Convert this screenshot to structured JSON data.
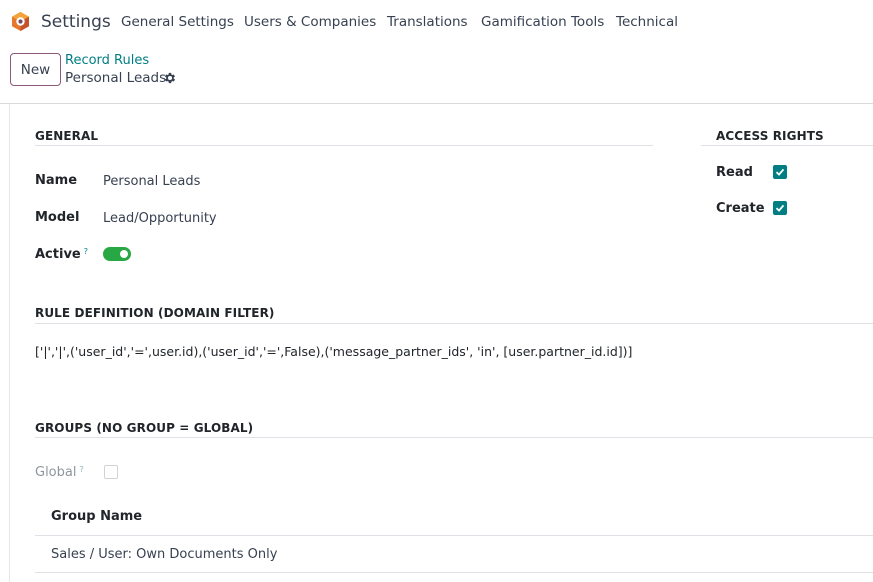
{
  "navbar": {
    "app_name": "Settings",
    "menu": [
      "General Settings",
      "Users & Companies",
      "Translations",
      "Gamification Tools",
      "Technical"
    ]
  },
  "control_panel": {
    "new_label": "New",
    "breadcrumb_parent": "Record Rules",
    "breadcrumb_current": "Personal Leads"
  },
  "general": {
    "title": "GENERAL",
    "name_label": "Name",
    "name_value": "Personal Leads",
    "model_label": "Model",
    "model_value": "Lead/Opportunity",
    "active_label": "Active",
    "active_help": "?",
    "active_value": true
  },
  "access_rights": {
    "title": "ACCESS RIGHTS",
    "read_label": "Read",
    "read_checked": true,
    "create_label": "Create",
    "create_checked": true
  },
  "rule_definition": {
    "title": "RULE DEFINITION (DOMAIN FILTER)",
    "domain": "['|','|',('user_id','=',user.id),('user_id','=',False),('message_partner_ids', 'in', [user.partner_id.id])]"
  },
  "groups": {
    "title": "GROUPS (NO GROUP = GLOBAL)",
    "global_label": "Global",
    "global_help": "?",
    "global_checked": false,
    "column_header": "Group Name",
    "rows": [
      "Sales / User: Own Documents Only"
    ]
  },
  "colors": {
    "accent": "#017e84",
    "brand": "#714b67",
    "toggle_on": "#28a745"
  }
}
